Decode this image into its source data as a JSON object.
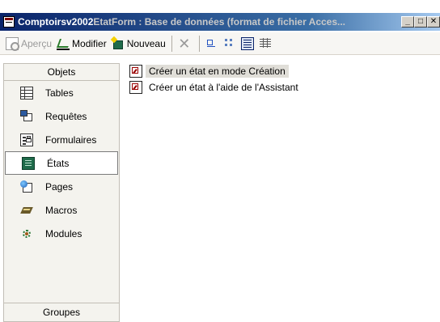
{
  "window": {
    "title_first": "Comptoirsv2002",
    "title_rest": "EtatForm : Base de données (format de fichier Acces...",
    "minimize_glyph": "_",
    "maximize_glyph": "□",
    "close_glyph": "✕"
  },
  "toolbar": {
    "preview_label": "Aperçu",
    "modify_label": "Modifier",
    "new_label": "Nouveau"
  },
  "sidebar": {
    "header": "Objets",
    "footer": "Groupes",
    "items": [
      {
        "label": "Tables",
        "icon": "table-icon"
      },
      {
        "label": "Requêtes",
        "icon": "query-icon"
      },
      {
        "label": "Formulaires",
        "icon": "form-icon"
      },
      {
        "label": "États",
        "icon": "report-icon",
        "selected": true
      },
      {
        "label": "Pages",
        "icon": "page-icon"
      },
      {
        "label": "Macros",
        "icon": "macro-icon"
      },
      {
        "label": "Modules",
        "icon": "module-icon"
      }
    ]
  },
  "main": {
    "items": [
      {
        "label": "Créer un état en mode Création",
        "icon": "create-report-icon"
      },
      {
        "label": "Créer un état à l'aide de l'Assistant",
        "icon": "create-report-icon"
      }
    ]
  },
  "colors": {
    "title_bar_start": "#0a246a",
    "title_bar_end": "#a6caf0",
    "selected_highlight": "#e0ded8",
    "panel_bg": "#f4f3ee"
  }
}
